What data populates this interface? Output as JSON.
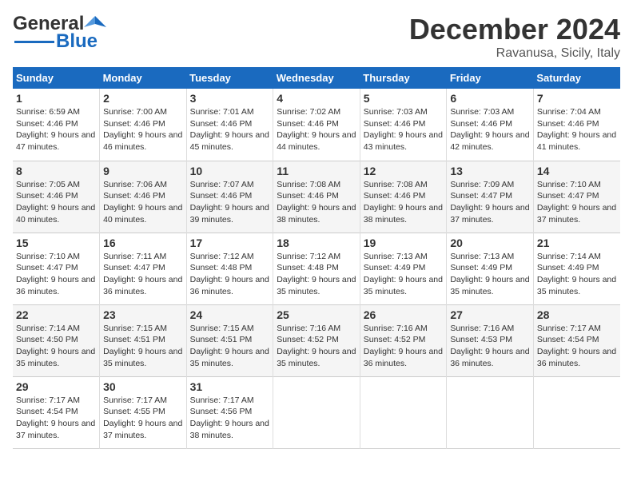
{
  "header": {
    "logo_line1": "General",
    "logo_line2": "Blue",
    "month": "December 2024",
    "location": "Ravanusa, Sicily, Italy"
  },
  "days_of_week": [
    "Sunday",
    "Monday",
    "Tuesday",
    "Wednesday",
    "Thursday",
    "Friday",
    "Saturday"
  ],
  "weeks": [
    [
      {
        "day": "1",
        "sunrise": "Sunrise: 6:59 AM",
        "sunset": "Sunset: 4:46 PM",
        "daylight": "Daylight: 9 hours and 47 minutes."
      },
      {
        "day": "2",
        "sunrise": "Sunrise: 7:00 AM",
        "sunset": "Sunset: 4:46 PM",
        "daylight": "Daylight: 9 hours and 46 minutes."
      },
      {
        "day": "3",
        "sunrise": "Sunrise: 7:01 AM",
        "sunset": "Sunset: 4:46 PM",
        "daylight": "Daylight: 9 hours and 45 minutes."
      },
      {
        "day": "4",
        "sunrise": "Sunrise: 7:02 AM",
        "sunset": "Sunset: 4:46 PM",
        "daylight": "Daylight: 9 hours and 44 minutes."
      },
      {
        "day": "5",
        "sunrise": "Sunrise: 7:03 AM",
        "sunset": "Sunset: 4:46 PM",
        "daylight": "Daylight: 9 hours and 43 minutes."
      },
      {
        "day": "6",
        "sunrise": "Sunrise: 7:03 AM",
        "sunset": "Sunset: 4:46 PM",
        "daylight": "Daylight: 9 hours and 42 minutes."
      },
      {
        "day": "7",
        "sunrise": "Sunrise: 7:04 AM",
        "sunset": "Sunset: 4:46 PM",
        "daylight": "Daylight: 9 hours and 41 minutes."
      }
    ],
    [
      {
        "day": "8",
        "sunrise": "Sunrise: 7:05 AM",
        "sunset": "Sunset: 4:46 PM",
        "daylight": "Daylight: 9 hours and 40 minutes."
      },
      {
        "day": "9",
        "sunrise": "Sunrise: 7:06 AM",
        "sunset": "Sunset: 4:46 PM",
        "daylight": "Daylight: 9 hours and 40 minutes."
      },
      {
        "day": "10",
        "sunrise": "Sunrise: 7:07 AM",
        "sunset": "Sunset: 4:46 PM",
        "daylight": "Daylight: 9 hours and 39 minutes."
      },
      {
        "day": "11",
        "sunrise": "Sunrise: 7:08 AM",
        "sunset": "Sunset: 4:46 PM",
        "daylight": "Daylight: 9 hours and 38 minutes."
      },
      {
        "day": "12",
        "sunrise": "Sunrise: 7:08 AM",
        "sunset": "Sunset: 4:46 PM",
        "daylight": "Daylight: 9 hours and 38 minutes."
      },
      {
        "day": "13",
        "sunrise": "Sunrise: 7:09 AM",
        "sunset": "Sunset: 4:47 PM",
        "daylight": "Daylight: 9 hours and 37 minutes."
      },
      {
        "day": "14",
        "sunrise": "Sunrise: 7:10 AM",
        "sunset": "Sunset: 4:47 PM",
        "daylight": "Daylight: 9 hours and 37 minutes."
      }
    ],
    [
      {
        "day": "15",
        "sunrise": "Sunrise: 7:10 AM",
        "sunset": "Sunset: 4:47 PM",
        "daylight": "Daylight: 9 hours and 36 minutes."
      },
      {
        "day": "16",
        "sunrise": "Sunrise: 7:11 AM",
        "sunset": "Sunset: 4:47 PM",
        "daylight": "Daylight: 9 hours and 36 minutes."
      },
      {
        "day": "17",
        "sunrise": "Sunrise: 7:12 AM",
        "sunset": "Sunset: 4:48 PM",
        "daylight": "Daylight: 9 hours and 36 minutes."
      },
      {
        "day": "18",
        "sunrise": "Sunrise: 7:12 AM",
        "sunset": "Sunset: 4:48 PM",
        "daylight": "Daylight: 9 hours and 35 minutes."
      },
      {
        "day": "19",
        "sunrise": "Sunrise: 7:13 AM",
        "sunset": "Sunset: 4:49 PM",
        "daylight": "Daylight: 9 hours and 35 minutes."
      },
      {
        "day": "20",
        "sunrise": "Sunrise: 7:13 AM",
        "sunset": "Sunset: 4:49 PM",
        "daylight": "Daylight: 9 hours and 35 minutes."
      },
      {
        "day": "21",
        "sunrise": "Sunrise: 7:14 AM",
        "sunset": "Sunset: 4:49 PM",
        "daylight": "Daylight: 9 hours and 35 minutes."
      }
    ],
    [
      {
        "day": "22",
        "sunrise": "Sunrise: 7:14 AM",
        "sunset": "Sunset: 4:50 PM",
        "daylight": "Daylight: 9 hours and 35 minutes."
      },
      {
        "day": "23",
        "sunrise": "Sunrise: 7:15 AM",
        "sunset": "Sunset: 4:51 PM",
        "daylight": "Daylight: 9 hours and 35 minutes."
      },
      {
        "day": "24",
        "sunrise": "Sunrise: 7:15 AM",
        "sunset": "Sunset: 4:51 PM",
        "daylight": "Daylight: 9 hours and 35 minutes."
      },
      {
        "day": "25",
        "sunrise": "Sunrise: 7:16 AM",
        "sunset": "Sunset: 4:52 PM",
        "daylight": "Daylight: 9 hours and 35 minutes."
      },
      {
        "day": "26",
        "sunrise": "Sunrise: 7:16 AM",
        "sunset": "Sunset: 4:52 PM",
        "daylight": "Daylight: 9 hours and 36 minutes."
      },
      {
        "day": "27",
        "sunrise": "Sunrise: 7:16 AM",
        "sunset": "Sunset: 4:53 PM",
        "daylight": "Daylight: 9 hours and 36 minutes."
      },
      {
        "day": "28",
        "sunrise": "Sunrise: 7:17 AM",
        "sunset": "Sunset: 4:54 PM",
        "daylight": "Daylight: 9 hours and 36 minutes."
      }
    ],
    [
      {
        "day": "29",
        "sunrise": "Sunrise: 7:17 AM",
        "sunset": "Sunset: 4:54 PM",
        "daylight": "Daylight: 9 hours and 37 minutes."
      },
      {
        "day": "30",
        "sunrise": "Sunrise: 7:17 AM",
        "sunset": "Sunset: 4:55 PM",
        "daylight": "Daylight: 9 hours and 37 minutes."
      },
      {
        "day": "31",
        "sunrise": "Sunrise: 7:17 AM",
        "sunset": "Sunset: 4:56 PM",
        "daylight": "Daylight: 9 hours and 38 minutes."
      },
      null,
      null,
      null,
      null
    ]
  ]
}
